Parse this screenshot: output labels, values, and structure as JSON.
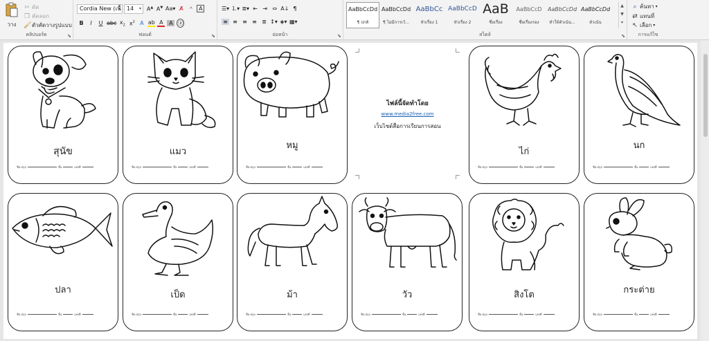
{
  "ribbon": {
    "clipboard": {
      "paste_label": "วาง",
      "cut_label": "ตัด",
      "copy_label": "คัดลอก",
      "format_painter_label": "ตัวคัดวางรูปแบบ",
      "group_label": "คลิปบอร์ด"
    },
    "font": {
      "font_name": "Cordia New (เนื้",
      "font_size": "14",
      "group_label": "ฟอนต์"
    },
    "paragraph": {
      "group_label": "ย่อหน้า"
    },
    "styles": {
      "group_label": "สไตล์",
      "items": [
        {
          "sample": "AaBbCcDd",
          "name": "¶ ปกติ"
        },
        {
          "sample": "AaBbCcDd",
          "name": "¶ ไม่มีการเว้..."
        },
        {
          "sample": "AaBbCc",
          "name": "หัวเรื่อง 1"
        },
        {
          "sample": "AaBbCcD",
          "name": "หัวเรื่อง 2"
        },
        {
          "sample": "AaB",
          "name": "ชื่อเรื่อง"
        },
        {
          "sample": "AaBbCcD",
          "name": "ชื่อเรื่องรอง"
        },
        {
          "sample": "AaBbCcDd",
          "name": "ทำให้ตัวเน้น..."
        },
        {
          "sample": "AaBbCcDd",
          "name": "ตัวเน้น"
        }
      ]
    },
    "editing": {
      "find_label": "ค้นหา",
      "replace_label": "แทนที่",
      "select_label": "เลือก",
      "group_label": "การแก้ไข"
    }
  },
  "cards": [
    {
      "animal": "dog",
      "name": "สุนัข"
    },
    {
      "animal": "cat",
      "name": "แมว"
    },
    {
      "animal": "pig",
      "name": "หมู"
    },
    {
      "animal": "chicken",
      "name": "ไก่"
    },
    {
      "animal": "bird",
      "name": "นก"
    },
    {
      "animal": "fish",
      "name": "ปลา"
    },
    {
      "animal": "duck",
      "name": "เป็ด"
    },
    {
      "animal": "horse",
      "name": "ม้า"
    },
    {
      "animal": "cow",
      "name": "วัว"
    },
    {
      "animal": "lion",
      "name": "สิงโต"
    },
    {
      "animal": "rabbit",
      "name": "กระต่าย"
    }
  ],
  "card_fields": {
    "name_label": "ชื่อ-สกุล",
    "class_label": "ชั้น",
    "number_label": "เลขที่"
  },
  "credit": {
    "line1": "ไฟล์นี้จัดทำโดย",
    "line2": "www.media2free.com",
    "line3": "เว็บไซต์สื่อการเรียนการสอน"
  }
}
